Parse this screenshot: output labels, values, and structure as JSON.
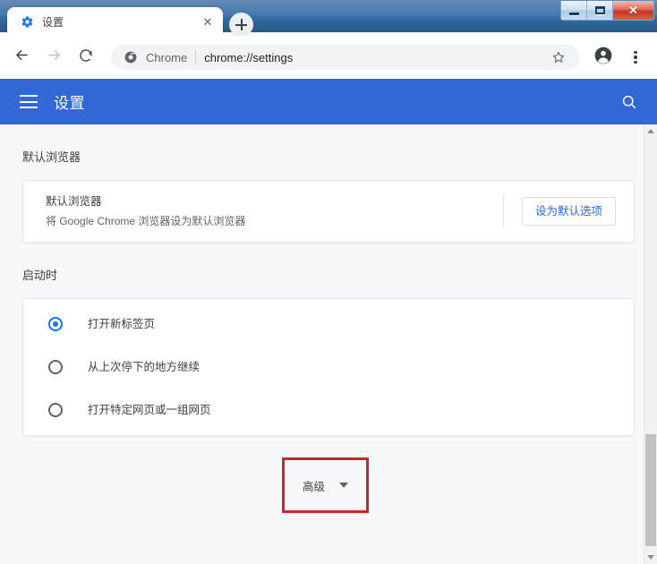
{
  "window": {
    "controls": {
      "minimize": "minimize-button",
      "maximize": "maximize-button",
      "close_glyph": "✕"
    }
  },
  "tabstrip": {
    "tabs": [
      {
        "title": "设置",
        "favicon": "gear-icon",
        "close_glyph": "✕",
        "active": true
      }
    ],
    "new_tab_label": "+"
  },
  "toolbar": {
    "back": "back-arrow-icon",
    "forward": "forward-arrow-icon",
    "reload": "reload-icon",
    "omnibox": {
      "scheme_icon": "chrome-logo-icon",
      "scheme_label": "Chrome",
      "separator": "|",
      "url": "chrome://settings"
    },
    "bookmark_star": "star-icon",
    "profile": "profile-avatar-icon",
    "menu": "three-dots-menu-icon"
  },
  "settings_header": {
    "menu_icon": "hamburger-menu-icon",
    "title": "设置",
    "search_icon": "search-icon",
    "background_color": "#3367d6"
  },
  "content": {
    "sections": [
      {
        "id": "default-browser",
        "title": "默认浏览器",
        "row": {
          "primary": "默认浏览器",
          "secondary": "将 Google Chrome 浏览器设为默认浏览器",
          "action_label": "设为默认选项",
          "action_color": "#3367d6"
        }
      },
      {
        "id": "on-startup",
        "title": "启动时",
        "options": [
          {
            "label": "打开新标签页",
            "selected": true
          },
          {
            "label": "从上次停下的地方继续",
            "selected": false
          },
          {
            "label": "打开特定网页或一组网页",
            "selected": false
          }
        ],
        "selected_color": "#1a73e8"
      }
    ],
    "advanced": {
      "label": "高级",
      "caret_icon": "chevron-down-icon",
      "highlight_color": "#c62828"
    },
    "background_color": "#f6f7f9"
  },
  "scrollbar": {
    "up_arrow": "scroll-up-arrow-icon",
    "down_arrow": "scroll-down-arrow-icon",
    "thumb_color": "#c1c1c1"
  }
}
